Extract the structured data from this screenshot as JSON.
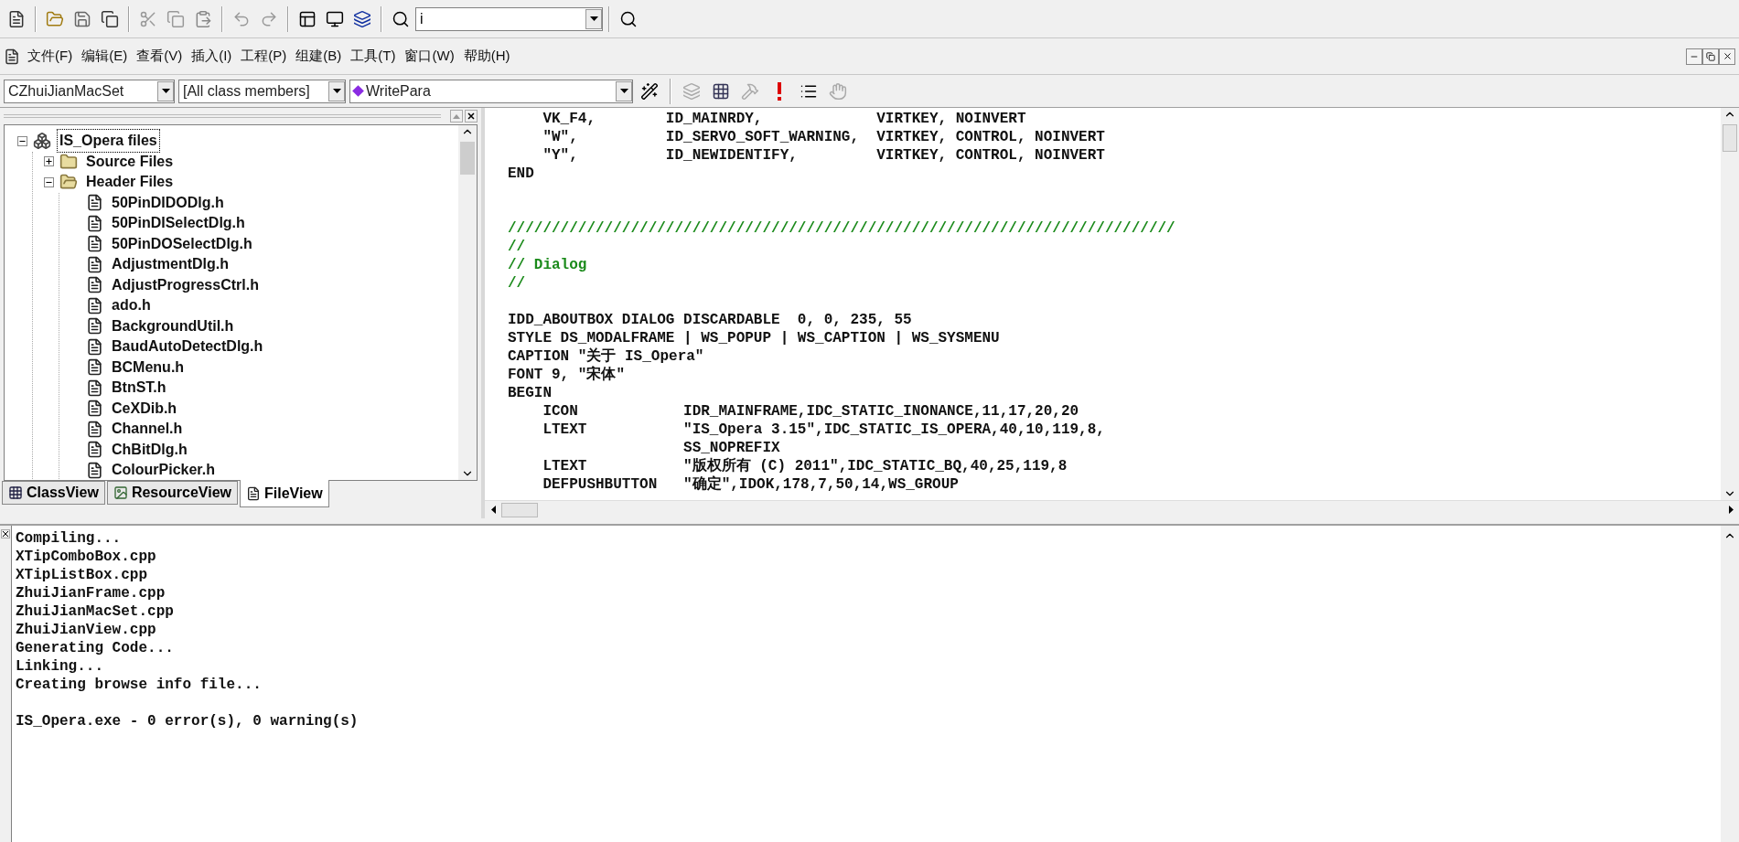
{
  "toolbar": {
    "find_value": "i"
  },
  "menu": [
    "文件(F)",
    "编辑(E)",
    "查看(V)",
    "插入(I)",
    "工程(P)",
    "组建(B)",
    "工具(T)",
    "窗口(W)",
    "帮助(H)"
  ],
  "wizard_bar": {
    "class": "CZhuiJianMacSet",
    "filter": "[All class members]",
    "member": "WritePara"
  },
  "workspace": {
    "tree": [
      {
        "label": "IS_Opera files",
        "kind": "project",
        "expanded": true,
        "selected": true,
        "children": [
          {
            "label": "Source Files",
            "kind": "folder",
            "expanded": false,
            "selected": false
          },
          {
            "label": "Header Files",
            "kind": "folder",
            "expanded": true,
            "selected": false,
            "children": [
              {
                "label": "50PinDIDODlg.h",
                "kind": "file",
                "selected": false
              },
              {
                "label": "50PinDISelectDlg.h",
                "kind": "file",
                "selected": false
              },
              {
                "label": "50PinDOSelectDlg.h",
                "kind": "file",
                "selected": false
              },
              {
                "label": "AdjustmentDlg.h",
                "kind": "file",
                "selected": false
              },
              {
                "label": "AdjustProgressCtrl.h",
                "kind": "file",
                "selected": false
              },
              {
                "label": "ado.h",
                "kind": "file",
                "selected": false
              },
              {
                "label": "BackgroundUtil.h",
                "kind": "file",
                "selected": false
              },
              {
                "label": "BaudAutoDetectDlg.h",
                "kind": "file",
                "selected": false
              },
              {
                "label": "BCMenu.h",
                "kind": "file",
                "selected": false
              },
              {
                "label": "BtnST.h",
                "kind": "file",
                "selected": false
              },
              {
                "label": "CeXDib.h",
                "kind": "file",
                "selected": false
              },
              {
                "label": "Channel.h",
                "kind": "file",
                "selected": false
              },
              {
                "label": "ChBitDlg.h",
                "kind": "file",
                "selected": false
              },
              {
                "label": "ColourPicker.h",
                "kind": "file",
                "selected": false
              }
            ]
          }
        ]
      }
    ],
    "tabs": [
      {
        "label": "ClassView",
        "kind": "class",
        "selected": false
      },
      {
        "label": "ResourceView",
        "kind": "resource",
        "selected": false
      },
      {
        "label": "FileView",
        "kind": "file",
        "selected": true
      }
    ]
  },
  "editor": {
    "lines": [
      {
        "kind": "code",
        "text": "    VK_F4,        ID_MAINRDY,             VIRTKEY, NOINVERT"
      },
      {
        "kind": "code",
        "text": "    \"W\",          ID_SERVO_SOFT_WARNING,  VIRTKEY, CONTROL, NOINVERT"
      },
      {
        "kind": "code",
        "text": "    \"Y\",          ID_NEWIDENTIFY,         VIRTKEY, CONTROL, NOINVERT"
      },
      {
        "kind": "code",
        "text": "END"
      },
      {
        "kind": "blank"
      },
      {
        "kind": "blank"
      },
      {
        "kind": "comment",
        "text": "////////////////////////////////////////////////////////////////////////////"
      },
      {
        "kind": "comment",
        "text": "//"
      },
      {
        "kind": "comment",
        "text": "// Dialog"
      },
      {
        "kind": "comment",
        "text": "//"
      },
      {
        "kind": "blank"
      },
      {
        "kind": "code",
        "text": "IDD_ABOUTBOX DIALOG DISCARDABLE  0, 0, 235, 55"
      },
      {
        "kind": "code",
        "text": "STYLE DS_MODALFRAME | WS_POPUP | WS_CAPTION | WS_SYSMENU"
      },
      {
        "kind": "code",
        "text": "CAPTION \"关于 IS_Opera\""
      },
      {
        "kind": "code",
        "text": "FONT 9, \"宋体\""
      },
      {
        "kind": "code",
        "text": "BEGIN"
      },
      {
        "kind": "code",
        "text": "    ICON            IDR_MAINFRAME,IDC_STATIC_INONANCE,11,17,20,20"
      },
      {
        "kind": "code",
        "text": "    LTEXT           \"IS_Opera 3.15\",IDC_STATIC_IS_OPERA,40,10,119,8,"
      },
      {
        "kind": "code",
        "text": "                    SS_NOPREFIX"
      },
      {
        "kind": "code",
        "text": "    LTEXT           \"版权所有 (C) 2011\",IDC_STATIC_BQ,40,25,119,8"
      },
      {
        "kind": "code",
        "text": "    DEFPUSHBUTTON   \"确定\",IDOK,178,7,50,14,WS_GROUP"
      }
    ]
  },
  "output": {
    "lines": [
      {
        "kind": "text",
        "text": "Compiling..."
      },
      {
        "kind": "text",
        "text": "XTipComboBox.cpp"
      },
      {
        "kind": "text",
        "text": "XTipListBox.cpp"
      },
      {
        "kind": "text",
        "text": "ZhuiJianFrame.cpp"
      },
      {
        "kind": "text",
        "text": "ZhuiJianMacSet.cpp"
      },
      {
        "kind": "text",
        "text": "ZhuiJianView.cpp"
      },
      {
        "kind": "text",
        "text": "Generating Code..."
      },
      {
        "kind": "text",
        "text": "Linking..."
      },
      {
        "kind": "text",
        "text": "Creating browse info file..."
      },
      {
        "kind": "blank"
      },
      {
        "kind": "text",
        "text": "IS_Opera.exe - 0 error(s), 0 warning(s)"
      }
    ]
  }
}
